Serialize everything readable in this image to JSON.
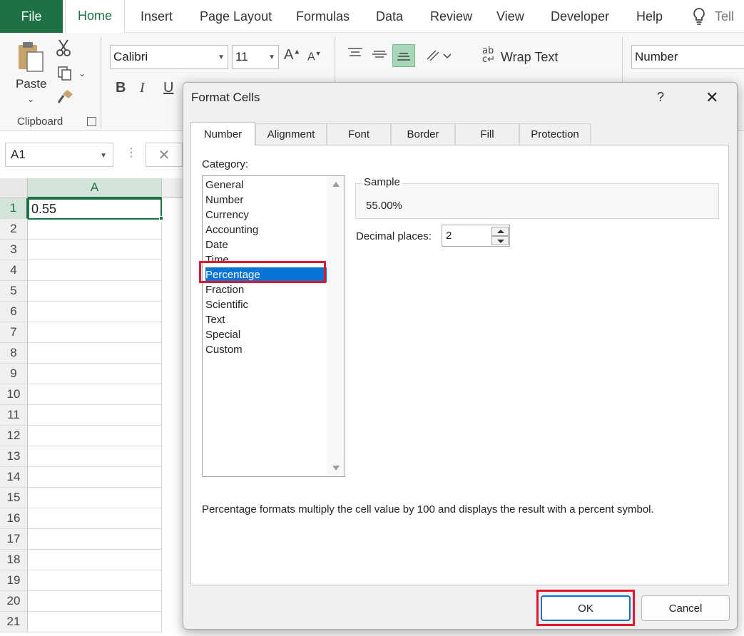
{
  "menu": {
    "file": "File",
    "tabs": [
      "Home",
      "Insert",
      "Page Layout",
      "Formulas",
      "Data",
      "Review",
      "View",
      "Developer",
      "Help"
    ],
    "tell": "Tell"
  },
  "ribbon": {
    "paste": "Paste",
    "clipboard": "Clipboard",
    "font_name": "Calibri",
    "font_size": "11",
    "bold": "B",
    "italic": "I",
    "underline": "U",
    "grow": "A",
    "shrink": "A",
    "wrap_text": "Wrap Text",
    "number_format": "Number"
  },
  "formula_bar": {
    "name_box": "A1",
    "cancel": "✕"
  },
  "sheet": {
    "column": "A",
    "rows": [
      "1",
      "2",
      "3",
      "4",
      "5",
      "6",
      "7",
      "8",
      "9",
      "10",
      "11",
      "12",
      "13",
      "14",
      "15",
      "16",
      "17",
      "18",
      "19",
      "20",
      "21"
    ],
    "a1_value": "0.55"
  },
  "dialog": {
    "title": "Format Cells",
    "help": "?",
    "close": "✕",
    "tabs": [
      "Number",
      "Alignment",
      "Font",
      "Border",
      "Fill",
      "Protection"
    ],
    "category_label": "Category:",
    "categories": [
      "General",
      "Number",
      "Currency",
      "Accounting",
      "Date",
      "Time",
      "Percentage",
      "Fraction",
      "Scientific",
      "Text",
      "Special",
      "Custom"
    ],
    "selected_category": "Percentage",
    "sample_label": "Sample",
    "sample_value": "55.00%",
    "decimal_label": "Decimal places:",
    "decimal_value": "2",
    "description": "Percentage formats multiply the cell value by 100 and displays the result with a percent symbol.",
    "ok": "OK",
    "cancel": "Cancel"
  },
  "colors": {
    "excel_green": "#1e7145",
    "selection_blue": "#0a74d6",
    "highlight_red": "#e0182d"
  }
}
